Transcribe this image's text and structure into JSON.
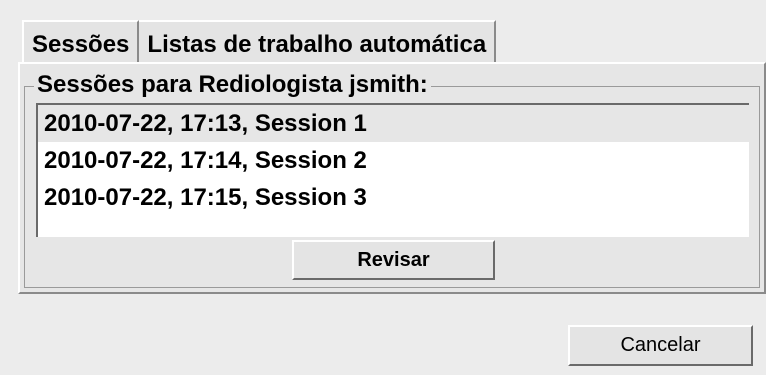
{
  "tabs": [
    {
      "label": "Sessões",
      "active": true
    },
    {
      "label": "Listas de trabalho automática",
      "active": false
    }
  ],
  "group": {
    "title": "Sessões para Rediologista jsmith:"
  },
  "sessions": [
    {
      "label": "2010-07-22, 17:13, Session 1",
      "selected": true
    },
    {
      "label": "2010-07-22, 17:14, Session 2",
      "selected": false
    },
    {
      "label": "2010-07-22, 17:15, Session 3",
      "selected": false
    }
  ],
  "buttons": {
    "review_label": "Revisar",
    "cancel_label": "Cancelar"
  }
}
